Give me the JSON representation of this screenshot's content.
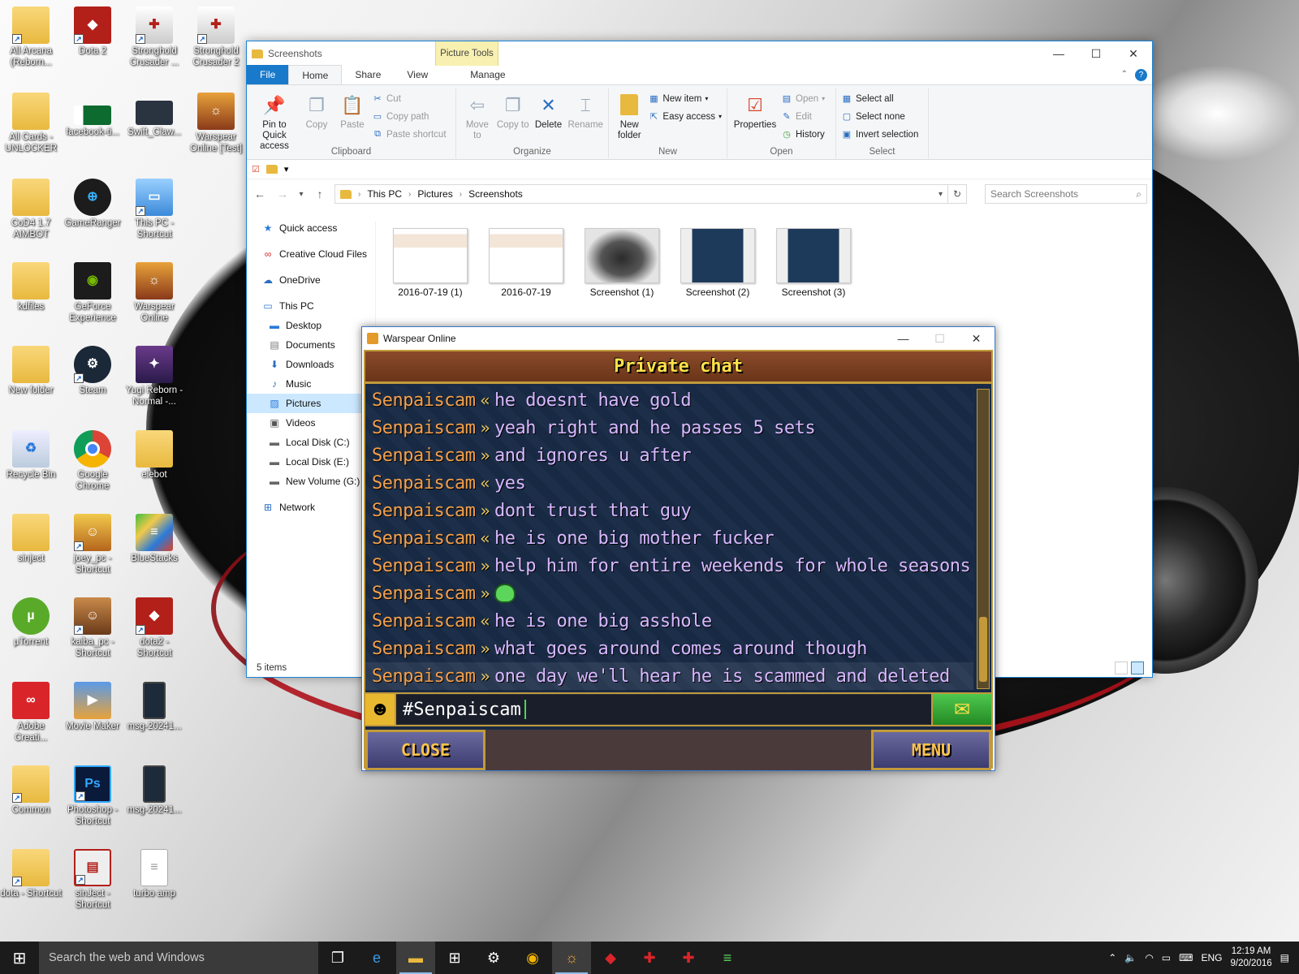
{
  "desktop": {
    "icons": [
      {
        "label": "All Arcana (Reborn...",
        "icon": "folder-icon"
      },
      {
        "label": "Dota 2",
        "icon": "dota-icon"
      },
      {
        "label": "Stronghold Crusader ...",
        "icon": "shield-icon"
      },
      {
        "label": "Stronghold Crusader 2",
        "icon": "shield-icon"
      },
      {
        "label": "All Cards - UNLOCKER",
        "icon": "folder-icon"
      },
      {
        "label": "facebook-ti...",
        "icon": "image-icon"
      },
      {
        "label": "Swift_Claw...",
        "icon": "image-icon"
      },
      {
        "label": "Warspear Online [Test]",
        "icon": "game-icon"
      },
      {
        "label": "CoD4 1.7 AIMBOT",
        "icon": "folder-icon"
      },
      {
        "label": "GameRanger",
        "icon": "gameranger-icon"
      },
      {
        "label": "This PC - Shortcut",
        "icon": "computer-icon"
      },
      {
        "label": "kdfiles",
        "icon": "folder-icon"
      },
      {
        "label": "GeForce Experience",
        "icon": "nvidia-icon"
      },
      {
        "label": "Warspear Online",
        "icon": "game-icon"
      },
      {
        "label": "New folder",
        "icon": "folder-icon"
      },
      {
        "label": "Steam",
        "icon": "steam-icon"
      },
      {
        "label": "Yugi Reborn - Normal -...",
        "icon": "game-icon"
      },
      {
        "label": "Recycle Bin",
        "icon": "recycle-bin-icon"
      },
      {
        "label": "Google Chrome",
        "icon": "chrome-icon"
      },
      {
        "label": "elebot",
        "icon": "folder-icon"
      },
      {
        "label": "sinject",
        "icon": "folder-icon"
      },
      {
        "label": "joey_pc - Shortcut",
        "icon": "game-icon"
      },
      {
        "label": "BlueStacks",
        "icon": "bluestacks-icon"
      },
      {
        "label": "µTorrent",
        "icon": "utorrent-icon"
      },
      {
        "label": "kaiba_pc - Shortcut",
        "icon": "game-icon"
      },
      {
        "label": "dota2 - Shortcut",
        "icon": "dota-icon"
      },
      {
        "label": "Adobe Creati...",
        "icon": "adobe-cc-icon"
      },
      {
        "label": "Movie Maker",
        "icon": "movie-maker-icon"
      },
      {
        "label": "msg-20241...",
        "icon": "phone-image-icon"
      },
      {
        "label": "Common",
        "icon": "folder-icon"
      },
      {
        "label": "Photoshop - Shortcut",
        "icon": "photoshop-icon"
      },
      {
        "label": "msg-20241...",
        "icon": "phone-image-icon"
      },
      {
        "label": "dota - Shortcut",
        "icon": "folder-icon"
      },
      {
        "label": "sinJect - Shortcut",
        "icon": "app-icon"
      },
      {
        "label": "turbo amp",
        "icon": "document-icon"
      }
    ]
  },
  "explorer": {
    "title": "Screenshots",
    "context_tab": "Picture Tools",
    "tabs": [
      "File",
      "Home",
      "Share",
      "View",
      "Manage"
    ],
    "ribbon": {
      "clipboard": {
        "label": "Clipboard",
        "pin": "Pin to Quick access",
        "copy": "Copy",
        "paste": "Paste",
        "cut": "Cut",
        "copy_path": "Copy path",
        "paste_shortcut": "Paste shortcut"
      },
      "organize": {
        "label": "Organize",
        "move_to": "Move to",
        "copy_to": "Copy to",
        "delete": "Delete",
        "rename": "Rename"
      },
      "new": {
        "label": "New",
        "new_folder": "New folder",
        "new_item": "New item",
        "easy_access": "Easy access"
      },
      "open": {
        "label": "Open",
        "properties": "Properties",
        "open": "Open",
        "edit": "Edit",
        "history": "History"
      },
      "select": {
        "label": "Select",
        "select_all": "Select all",
        "select_none": "Select none",
        "invert": "Invert selection"
      }
    },
    "breadcrumb": [
      "This PC",
      "Pictures",
      "Screenshots"
    ],
    "search_placeholder": "Search Screenshots",
    "nav": [
      {
        "label": "Quick access",
        "icon": "star-icon"
      },
      {
        "label": "Creative Cloud Files",
        "icon": "creative-cloud-icon"
      },
      {
        "label": "OneDrive",
        "icon": "cloud-icon"
      },
      {
        "label": "This PC",
        "icon": "computer-icon"
      },
      {
        "label": "Desktop",
        "icon": "desktop-icon"
      },
      {
        "label": "Documents",
        "icon": "documents-icon"
      },
      {
        "label": "Downloads",
        "icon": "download-icon"
      },
      {
        "label": "Music",
        "icon": "music-icon"
      },
      {
        "label": "Pictures",
        "icon": "pictures-icon"
      },
      {
        "label": "Videos",
        "icon": "videos-icon"
      },
      {
        "label": "Local Disk (C:)",
        "icon": "disk-icon"
      },
      {
        "label": "Local Disk (E:)",
        "icon": "disk-icon"
      },
      {
        "label": "New Volume (G:)",
        "icon": "disk-icon"
      },
      {
        "label": "Network",
        "icon": "network-icon"
      }
    ],
    "files": [
      "2016-07-19 (1)",
      "2016-07-19",
      "Screenshot (1)",
      "Screenshot (2)",
      "Screenshot (3)"
    ],
    "status": "5 items"
  },
  "game": {
    "window_title": "Warspear Online",
    "header": "Private chat",
    "messages": [
      {
        "name": "Senpaiscam",
        "dir": "«",
        "text": "he doesnt have gold"
      },
      {
        "name": "Senpaiscam",
        "dir": "»",
        "text": "yeah right and he passes 5 sets"
      },
      {
        "name": "Senpaiscam",
        "dir": "»",
        "text": "and ignores u after"
      },
      {
        "name": "Senpaiscam",
        "dir": "«",
        "text": "yes"
      },
      {
        "name": "Senpaiscam",
        "dir": "»",
        "text": "dont trust that guy"
      },
      {
        "name": "Senpaiscam",
        "dir": "«",
        "text": "he is one big mother fucker"
      },
      {
        "name": "Senpaiscam",
        "dir": "»",
        "text": "help him for entire weekends for whole seasons"
      },
      {
        "name": "Senpaiscam",
        "dir": "»",
        "text": ""
      },
      {
        "name": "Senpaiscam",
        "dir": "«",
        "text": "he is one big asshole"
      },
      {
        "name": "Senpaiscam",
        "dir": "»",
        "text": "what goes around comes around though"
      },
      {
        "name": "Senpaiscam",
        "dir": "»",
        "text": "one day we'll hear he is scammed and deleted"
      }
    ],
    "input_value": "#Senpaiscam",
    "close_label": "CLOSE",
    "menu_label": "MENU"
  },
  "taskbar": {
    "search_placeholder": "Search the web and Windows",
    "lang": "ENG",
    "time": "12:19 AM",
    "date": "9/20/2016"
  }
}
